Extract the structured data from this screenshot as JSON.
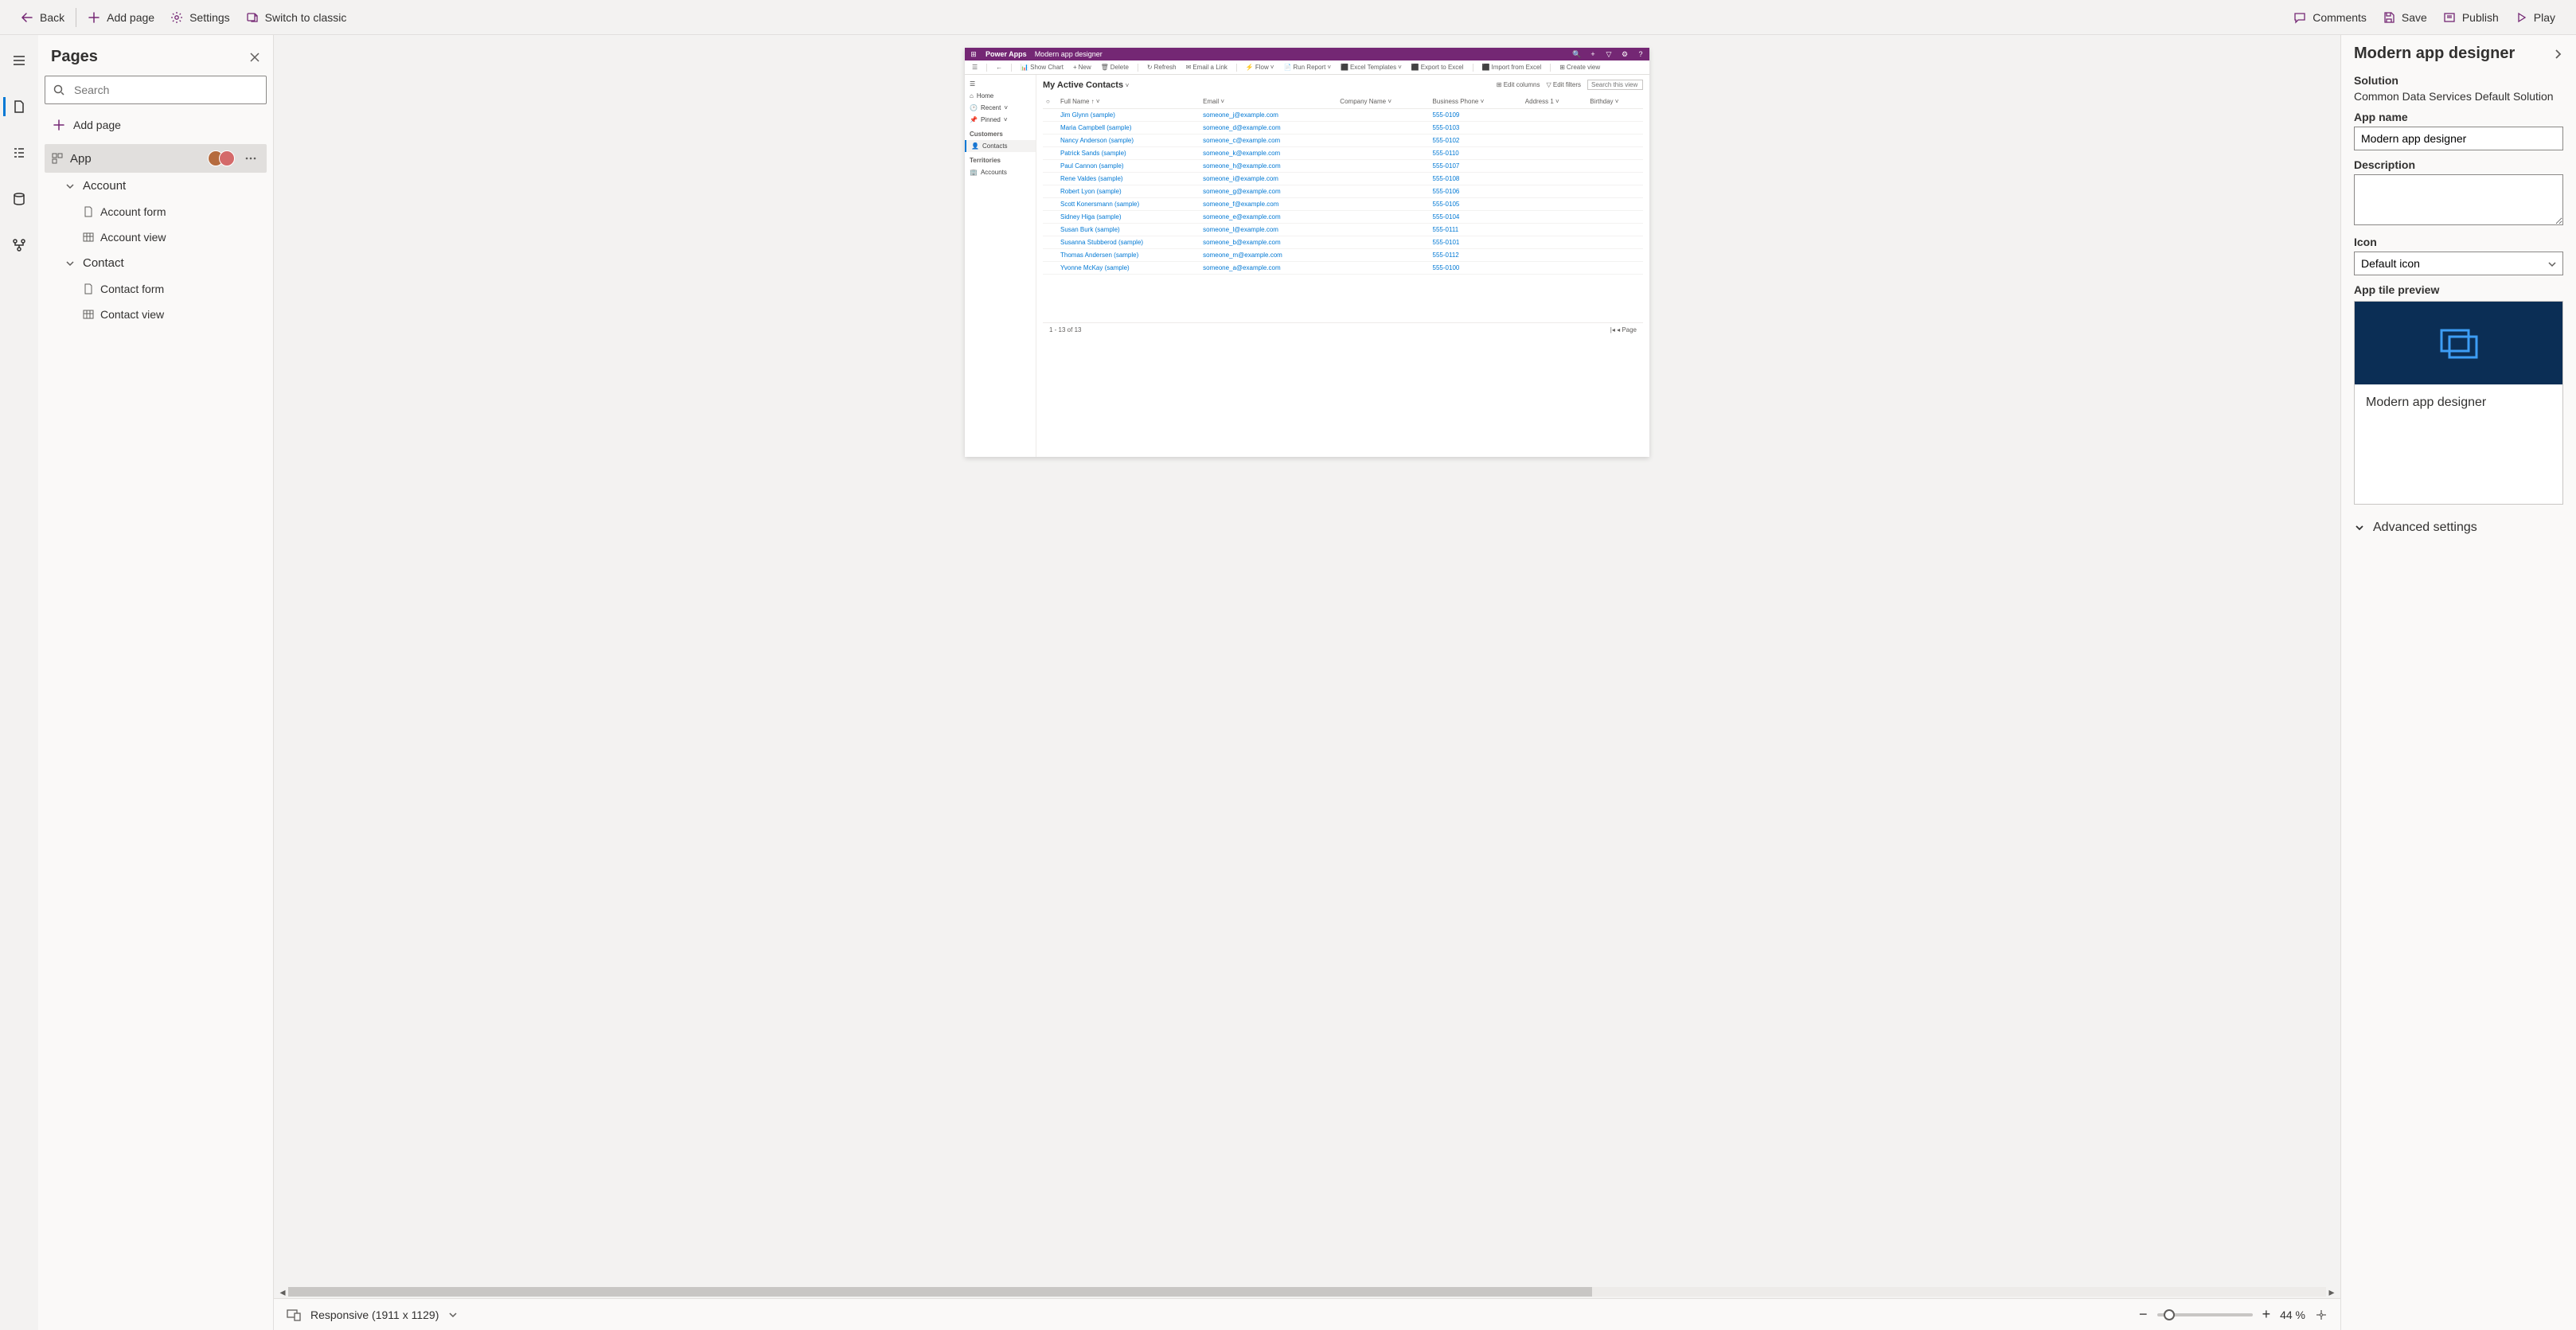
{
  "topbar": {
    "back": "Back",
    "add_page": "Add page",
    "settings": "Settings",
    "switch_classic": "Switch to classic",
    "comments": "Comments",
    "save": "Save",
    "publish": "Publish",
    "play": "Play"
  },
  "pages_panel": {
    "title": "Pages",
    "search_placeholder": "Search",
    "add_page": "Add page",
    "tree": {
      "app": "App",
      "account": "Account",
      "account_form": "Account form",
      "account_view": "Account view",
      "contact": "Contact",
      "contact_form": "Contact form",
      "contact_view": "Contact view"
    }
  },
  "preview": {
    "brand": "Power Apps",
    "app_name": "Modern app designer",
    "cmdbar": {
      "show_chart": "Show Chart",
      "new": "New",
      "delete": "Delete",
      "refresh": "Refresh",
      "email_link": "Email a Link",
      "flow": "Flow",
      "run_report": "Run Report",
      "excel_templates": "Excel Templates",
      "export_excel": "Export to Excel",
      "import_excel": "Import from Excel",
      "create_view": "Create view"
    },
    "leftnav": {
      "home": "Home",
      "recent": "Recent",
      "pinned": "Pinned",
      "customers": "Customers",
      "contacts": "Contacts",
      "territories": "Territories",
      "accounts": "Accounts"
    },
    "view_title": "My Active Contacts",
    "tools": {
      "edit_columns": "Edit columns",
      "edit_filters": "Edit filters",
      "search_placeholder": "Search this view"
    },
    "columns": {
      "full_name": "Full Name",
      "email": "Email",
      "company": "Company Name",
      "phone": "Business Phone",
      "address": "Address 1",
      "birthday": "Birthday"
    },
    "rows": [
      {
        "name": "Jim Glynn (sample)",
        "email": "someone_j@example.com",
        "phone": "555-0109"
      },
      {
        "name": "Maria Campbell (sample)",
        "email": "someone_d@example.com",
        "phone": "555-0103"
      },
      {
        "name": "Nancy Anderson (sample)",
        "email": "someone_c@example.com",
        "phone": "555-0102"
      },
      {
        "name": "Patrick Sands (sample)",
        "email": "someone_k@example.com",
        "phone": "555-0110"
      },
      {
        "name": "Paul Cannon (sample)",
        "email": "someone_h@example.com",
        "phone": "555-0107"
      },
      {
        "name": "Rene Valdes (sample)",
        "email": "someone_i@example.com",
        "phone": "555-0108"
      },
      {
        "name": "Robert Lyon (sample)",
        "email": "someone_g@example.com",
        "phone": "555-0106"
      },
      {
        "name": "Scott Konersmann (sample)",
        "email": "someone_f@example.com",
        "phone": "555-0105"
      },
      {
        "name": "Sidney Higa (sample)",
        "email": "someone_e@example.com",
        "phone": "555-0104"
      },
      {
        "name": "Susan Burk (sample)",
        "email": "someone_l@example.com",
        "phone": "555-0111"
      },
      {
        "name": "Susanna Stubberod (sample)",
        "email": "someone_b@example.com",
        "phone": "555-0101"
      },
      {
        "name": "Thomas Andersen (sample)",
        "email": "someone_m@example.com",
        "phone": "555-0112"
      },
      {
        "name": "Yvonne McKay (sample)",
        "email": "someone_a@example.com",
        "phone": "555-0100"
      }
    ],
    "footer": {
      "count": "1 - 13 of 13",
      "page": "Page"
    }
  },
  "status": {
    "responsive": "Responsive (1911 x 1129)",
    "zoom": "44 %"
  },
  "props": {
    "title": "Modern app designer",
    "solution_label": "Solution",
    "solution_value": "Common Data Services Default Solution",
    "app_name_label": "App name",
    "app_name_value": "Modern app designer",
    "description_label": "Description",
    "icon_label": "Icon",
    "icon_value": "Default icon",
    "tile_label": "App tile preview",
    "tile_name": "Modern app designer",
    "advanced": "Advanced settings"
  }
}
